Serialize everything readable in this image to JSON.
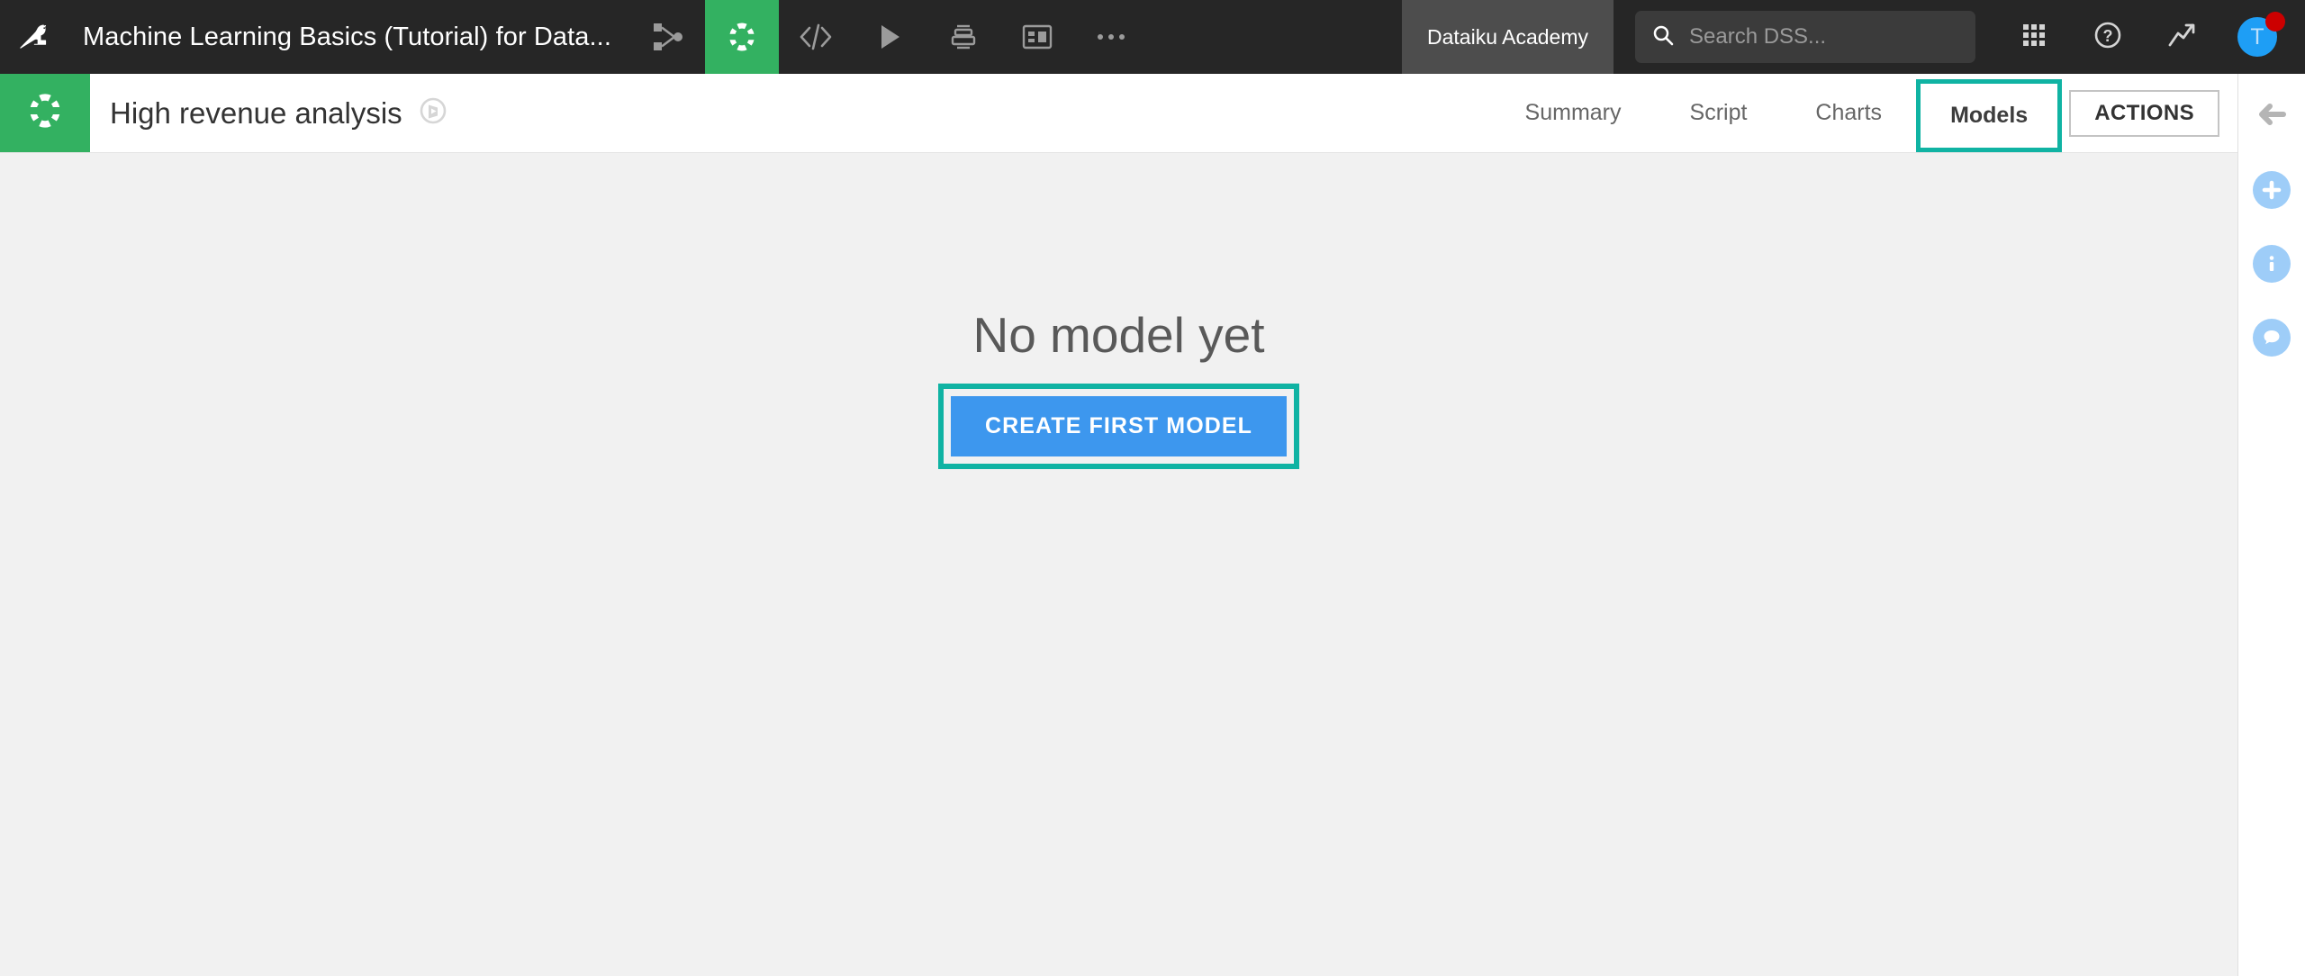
{
  "topbar": {
    "logo_icon": "dataiku-bird-icon",
    "project_title": "Machine Learning Basics (Tutorial) for Data...",
    "icons": [
      {
        "name": "flow-icon",
        "label": "Flow",
        "active": false
      },
      {
        "name": "lab-icon",
        "label": "Lab",
        "active": true
      },
      {
        "name": "code-icon",
        "label": "Code",
        "active": false
      },
      {
        "name": "run-icon",
        "label": "Run",
        "active": false
      },
      {
        "name": "jobs-icon",
        "label": "Jobs",
        "active": false
      },
      {
        "name": "dashboard-icon",
        "label": "Dashboards",
        "active": false
      },
      {
        "name": "more-icon",
        "label": "More",
        "active": false
      }
    ],
    "academy_badge": "Dataiku Academy",
    "search": {
      "placeholder": "Search DSS...",
      "value": "",
      "icon": "search-icon"
    },
    "right_icons": [
      {
        "name": "apps-grid-icon",
        "label": "Apps"
      },
      {
        "name": "help-icon",
        "label": "Help"
      },
      {
        "name": "activity-trend-icon",
        "label": "Activity"
      }
    ],
    "avatar": {
      "initial": "T",
      "has_notification": true,
      "notification_color": "#cc0000",
      "background": "#1e9ef5"
    }
  },
  "subheader": {
    "project_icon": "dataiku-analysis-icon",
    "analysis_name": "High revenue analysis",
    "navigator_icon": "navigator-compass-icon",
    "tabs": [
      {
        "label": "Summary",
        "selected": false,
        "highlighted": false
      },
      {
        "label": "Script",
        "selected": false,
        "highlighted": false
      },
      {
        "label": "Charts",
        "selected": false,
        "highlighted": false
      },
      {
        "label": "Models",
        "selected": true,
        "highlighted": true
      }
    ],
    "actions_label": "ACTIONS"
  },
  "right_rail": [
    {
      "name": "collapse-back-arrow-icon",
      "glyph": "←",
      "style": "plain"
    },
    {
      "name": "add-plus-icon",
      "glyph": "+",
      "style": "circle"
    },
    {
      "name": "info-icon",
      "glyph": "i",
      "style": "circle"
    },
    {
      "name": "comments-icon",
      "glyph": "💬",
      "style": "circle"
    }
  ],
  "main": {
    "empty_title": "No model yet",
    "cta_label": "CREATE FIRST MODEL"
  },
  "colors": {
    "topbar_bg": "#262626",
    "accent_green": "#33b161",
    "highlight_teal": "#10b3a3",
    "cta_blue": "#3d97ee",
    "content_bg": "#f1f1f1",
    "academy_badge_bg": "#4d4d4d",
    "rail_icon_blue": "#9ecdf8"
  }
}
